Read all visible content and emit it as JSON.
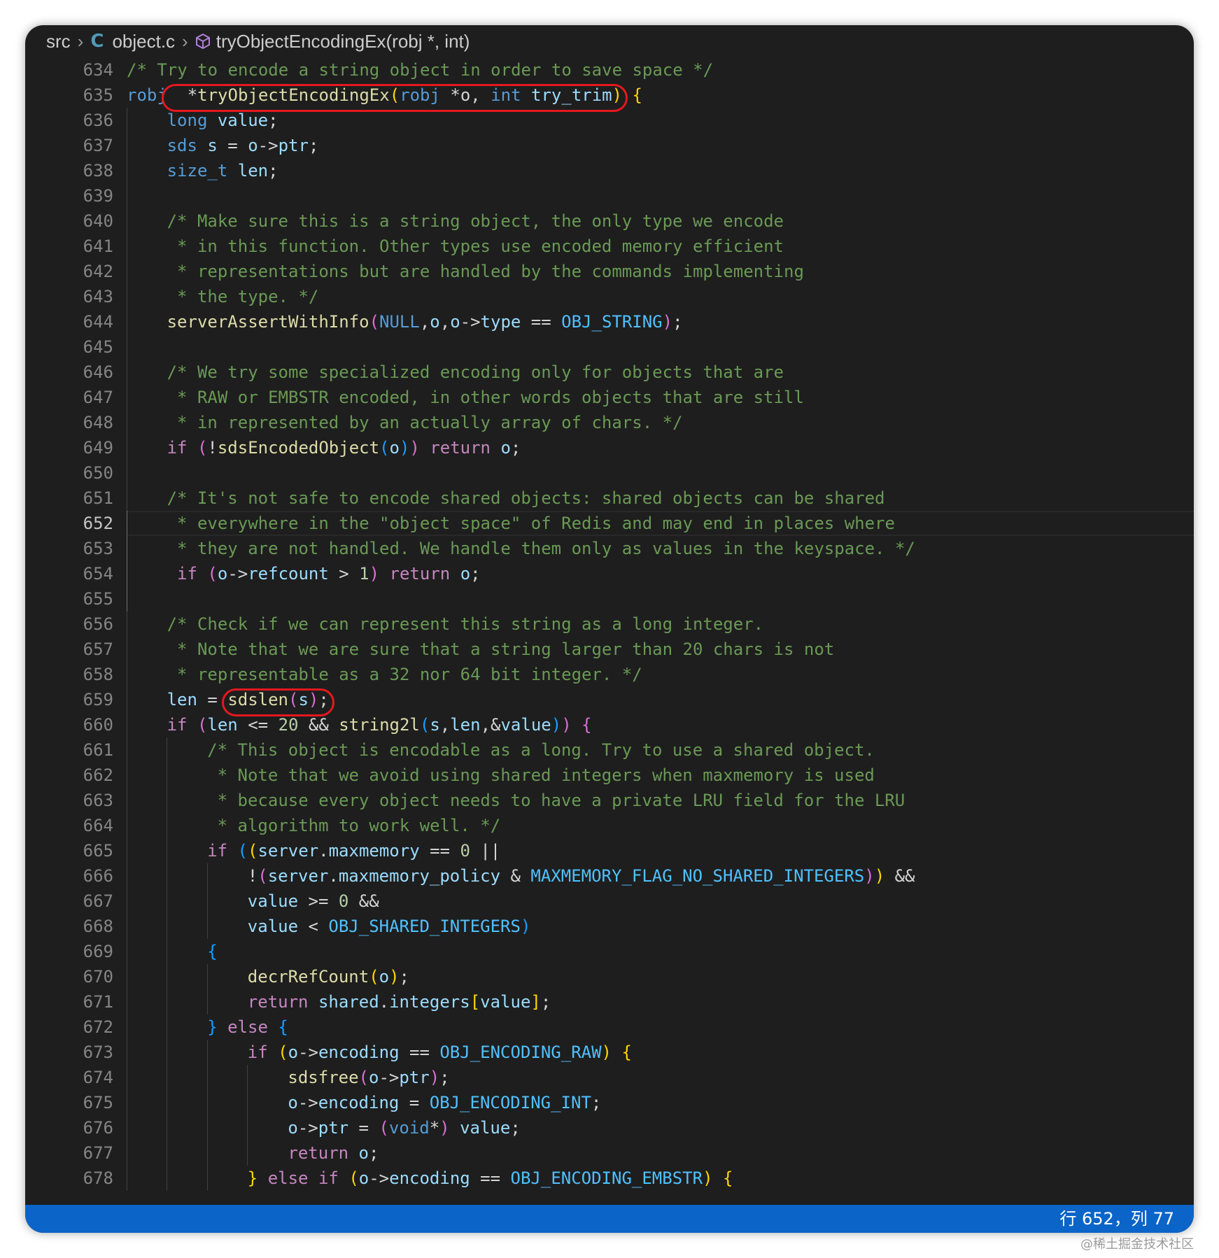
{
  "breadcrumb": {
    "folder": "src",
    "file_icon": "C",
    "file": "object.c",
    "symbol": "tryObjectEncodingEx(robj *, int)"
  },
  "editor": {
    "active_line": 652,
    "lines": [
      {
        "n": 634,
        "indent": 0,
        "tokens": [
          [
            "cmt",
            "/* Try to encode a string object in order to save space */"
          ]
        ]
      },
      {
        "n": 635,
        "indent": 0,
        "tokens": [
          [
            "kw",
            "robj"
          ],
          [
            "",
            "  *"
          ],
          [
            "fn",
            "tryObjectEncodingEx"
          ],
          [
            "b1",
            "("
          ],
          [
            "kw",
            "robj"
          ],
          [
            "",
            " *o, "
          ],
          [
            "kw",
            "int"
          ],
          [
            "",
            " "
          ],
          [
            "var",
            "try_trim"
          ],
          [
            "b1",
            ")"
          ],
          [
            "",
            " "
          ],
          [
            "b1",
            "{"
          ]
        ]
      },
      {
        "n": 636,
        "indent": 1,
        "tokens": [
          [
            "kw",
            "long"
          ],
          [
            "",
            " "
          ],
          [
            "var",
            "value"
          ],
          [
            "",
            ";"
          ]
        ]
      },
      {
        "n": 637,
        "indent": 1,
        "tokens": [
          [
            "kw",
            "sds"
          ],
          [
            "",
            " "
          ],
          [
            "var",
            "s"
          ],
          [
            "",
            " = "
          ],
          [
            "var",
            "o"
          ],
          [
            "",
            "->"
          ],
          [
            "var",
            "ptr"
          ],
          [
            "",
            ";"
          ]
        ]
      },
      {
        "n": 638,
        "indent": 1,
        "tokens": [
          [
            "kw",
            "size_t"
          ],
          [
            "",
            " "
          ],
          [
            "var",
            "len"
          ],
          [
            "",
            ";"
          ]
        ]
      },
      {
        "n": 639,
        "indent": 1,
        "tokens": []
      },
      {
        "n": 640,
        "indent": 1,
        "tokens": [
          [
            "cmt",
            "/* Make sure this is a string object, the only type we encode"
          ]
        ]
      },
      {
        "n": 641,
        "indent": 1,
        "tokens": [
          [
            "cmt",
            " * in this function. Other types use encoded memory efficient"
          ]
        ]
      },
      {
        "n": 642,
        "indent": 1,
        "tokens": [
          [
            "cmt",
            " * representations but are handled by the commands implementing"
          ]
        ]
      },
      {
        "n": 643,
        "indent": 1,
        "tokens": [
          [
            "cmt",
            " * the type. */"
          ]
        ]
      },
      {
        "n": 644,
        "indent": 1,
        "tokens": [
          [
            "fn",
            "serverAssertWithInfo"
          ],
          [
            "b2",
            "("
          ],
          [
            "kw",
            "NULL"
          ],
          [
            "",
            ","
          ],
          [
            "var",
            "o"
          ],
          [
            "",
            ","
          ],
          [
            "var",
            "o"
          ],
          [
            "",
            "->"
          ],
          [
            "var",
            "type"
          ],
          [
            "",
            " == "
          ],
          [
            "mac",
            "OBJ_STRING"
          ],
          [
            "b2",
            ")"
          ],
          [
            "",
            ";"
          ]
        ]
      },
      {
        "n": 645,
        "indent": 1,
        "tokens": []
      },
      {
        "n": 646,
        "indent": 1,
        "tokens": [
          [
            "cmt",
            "/* We try some specialized encoding only for objects that are"
          ]
        ]
      },
      {
        "n": 647,
        "indent": 1,
        "tokens": [
          [
            "cmt",
            " * RAW or EMBSTR encoded, in other words objects that are still"
          ]
        ]
      },
      {
        "n": 648,
        "indent": 1,
        "tokens": [
          [
            "cmt",
            " * in represented by an actually array of chars. */"
          ]
        ]
      },
      {
        "n": 649,
        "indent": 1,
        "tokens": [
          [
            "ctl",
            "if"
          ],
          [
            "",
            " "
          ],
          [
            "b2",
            "("
          ],
          [
            "",
            "!"
          ],
          [
            "fn",
            "sdsEncodedObject"
          ],
          [
            "b3",
            "("
          ],
          [
            "var",
            "o"
          ],
          [
            "b3",
            ")"
          ],
          [
            "b2",
            ")"
          ],
          [
            "",
            " "
          ],
          [
            "ctl",
            "return"
          ],
          [
            "",
            " "
          ],
          [
            "var",
            "o"
          ],
          [
            "",
            ";"
          ]
        ]
      },
      {
        "n": 650,
        "indent": 1,
        "tokens": []
      },
      {
        "n": 651,
        "indent": 1,
        "tokens": [
          [
            "cmt",
            "/* It's not safe to encode shared objects: shared objects can be shared"
          ]
        ]
      },
      {
        "n": 652,
        "indent": 1,
        "tokens": [
          [
            "cmt",
            " * everywhere in the \"object space\" of Redis and may end in places where"
          ]
        ]
      },
      {
        "n": 653,
        "indent": 1,
        "tokens": [
          [
            "cmt",
            " * they are not handled. We handle them only as values in the keyspace. */"
          ]
        ]
      },
      {
        "n": 654,
        "indent": 1,
        "tokens": [
          [
            "ctl",
            " if"
          ],
          [
            "",
            " "
          ],
          [
            "b2",
            "("
          ],
          [
            "var",
            "o"
          ],
          [
            "",
            "->"
          ],
          [
            "var",
            "refcount"
          ],
          [
            "",
            " > "
          ],
          [
            "num",
            "1"
          ],
          [
            "b2",
            ")"
          ],
          [
            "",
            " "
          ],
          [
            "ctl",
            "return"
          ],
          [
            "",
            " "
          ],
          [
            "var",
            "o"
          ],
          [
            "",
            ";"
          ]
        ]
      },
      {
        "n": 655,
        "indent": 1,
        "tokens": []
      },
      {
        "n": 656,
        "indent": 1,
        "tokens": [
          [
            "cmt",
            "/* Check if we can represent this string as a long integer."
          ]
        ]
      },
      {
        "n": 657,
        "indent": 1,
        "tokens": [
          [
            "cmt",
            " * Note that we are sure that a string larger than 20 chars is not"
          ]
        ]
      },
      {
        "n": 658,
        "indent": 1,
        "tokens": [
          [
            "cmt",
            " * representable as a 32 nor 64 bit integer. */"
          ]
        ]
      },
      {
        "n": 659,
        "indent": 1,
        "tokens": [
          [
            "var",
            "len"
          ],
          [
            "",
            " = "
          ],
          [
            "fn",
            "sdslen"
          ],
          [
            "b2",
            "("
          ],
          [
            "var",
            "s"
          ],
          [
            "b2",
            ")"
          ],
          [
            "",
            ";"
          ]
        ]
      },
      {
        "n": 660,
        "indent": 1,
        "tokens": [
          [
            "ctl",
            "if"
          ],
          [
            "",
            " "
          ],
          [
            "b2",
            "("
          ],
          [
            "var",
            "len"
          ],
          [
            "",
            " <= "
          ],
          [
            "num",
            "20"
          ],
          [
            "",
            " && "
          ],
          [
            "fn",
            "string2l"
          ],
          [
            "b3",
            "("
          ],
          [
            "var",
            "s"
          ],
          [
            "",
            ","
          ],
          [
            "var",
            "len"
          ],
          [
            "",
            ",&"
          ],
          [
            "var",
            "value"
          ],
          [
            "b3",
            ")"
          ],
          [
            "b2",
            ")"
          ],
          [
            "",
            " "
          ],
          [
            "b2",
            "{"
          ]
        ]
      },
      {
        "n": 661,
        "indent": 2,
        "tokens": [
          [
            "cmt",
            "/* This object is encodable as a long. Try to use a shared object."
          ]
        ]
      },
      {
        "n": 662,
        "indent": 2,
        "tokens": [
          [
            "cmt",
            " * Note that we avoid using shared integers when maxmemory is used"
          ]
        ]
      },
      {
        "n": 663,
        "indent": 2,
        "tokens": [
          [
            "cmt",
            " * because every object needs to have a private LRU field for the LRU"
          ]
        ]
      },
      {
        "n": 664,
        "indent": 2,
        "tokens": [
          [
            "cmt",
            " * algorithm to work well. */"
          ]
        ]
      },
      {
        "n": 665,
        "indent": 2,
        "tokens": [
          [
            "ctl",
            "if"
          ],
          [
            "",
            " "
          ],
          [
            "b3",
            "("
          ],
          [
            "b1",
            "("
          ],
          [
            "var",
            "server"
          ],
          [
            "",
            "."
          ],
          [
            "var",
            "maxmemory"
          ],
          [
            "",
            " == "
          ],
          [
            "num",
            "0"
          ],
          [
            "",
            " ||"
          ]
        ]
      },
      {
        "n": 666,
        "indent": 3,
        "tokens": [
          [
            "",
            "!"
          ],
          [
            "b2",
            "("
          ],
          [
            "var",
            "server"
          ],
          [
            "",
            "."
          ],
          [
            "var",
            "maxmemory_policy"
          ],
          [
            "",
            " & "
          ],
          [
            "mac",
            "MAXMEMORY_FLAG_NO_SHARED_INTEGERS"
          ],
          [
            "b2",
            ")"
          ],
          [
            "b1",
            ")"
          ],
          [
            "",
            " &&"
          ]
        ]
      },
      {
        "n": 667,
        "indent": 3,
        "tokens": [
          [
            "var",
            "value"
          ],
          [
            "",
            " >= "
          ],
          [
            "num",
            "0"
          ],
          [
            "",
            " &&"
          ]
        ]
      },
      {
        "n": 668,
        "indent": 3,
        "tokens": [
          [
            "var",
            "value"
          ],
          [
            "",
            " < "
          ],
          [
            "mac",
            "OBJ_SHARED_INTEGERS"
          ],
          [
            "b3",
            ")"
          ]
        ]
      },
      {
        "n": 669,
        "indent": 2,
        "tokens": [
          [
            "b3",
            "{"
          ]
        ]
      },
      {
        "n": 670,
        "indent": 3,
        "tokens": [
          [
            "fn",
            "decrRefCount"
          ],
          [
            "b1",
            "("
          ],
          [
            "var",
            "o"
          ],
          [
            "b1",
            ")"
          ],
          [
            "",
            ";"
          ]
        ]
      },
      {
        "n": 671,
        "indent": 3,
        "tokens": [
          [
            "ctl",
            "return"
          ],
          [
            "",
            " "
          ],
          [
            "var",
            "shared"
          ],
          [
            "",
            "."
          ],
          [
            "var",
            "integers"
          ],
          [
            "b1",
            "["
          ],
          [
            "var",
            "value"
          ],
          [
            "b1",
            "]"
          ],
          [
            "",
            ";"
          ]
        ]
      },
      {
        "n": 672,
        "indent": 2,
        "tokens": [
          [
            "b3",
            "}"
          ],
          [
            "",
            " "
          ],
          [
            "ctl",
            "else"
          ],
          [
            "",
            " "
          ],
          [
            "b3",
            "{"
          ]
        ]
      },
      {
        "n": 673,
        "indent": 3,
        "tokens": [
          [
            "ctl",
            "if"
          ],
          [
            "",
            " "
          ],
          [
            "b1",
            "("
          ],
          [
            "var",
            "o"
          ],
          [
            "",
            "->"
          ],
          [
            "var",
            "encoding"
          ],
          [
            "",
            " == "
          ],
          [
            "mac",
            "OBJ_ENCODING_RAW"
          ],
          [
            "b1",
            ")"
          ],
          [
            "",
            " "
          ],
          [
            "b1",
            "{"
          ]
        ]
      },
      {
        "n": 674,
        "indent": 4,
        "tokens": [
          [
            "fn",
            "sdsfree"
          ],
          [
            "b2",
            "("
          ],
          [
            "var",
            "o"
          ],
          [
            "",
            "->"
          ],
          [
            "var",
            "ptr"
          ],
          [
            "b2",
            ")"
          ],
          [
            "",
            ";"
          ]
        ]
      },
      {
        "n": 675,
        "indent": 4,
        "tokens": [
          [
            "var",
            "o"
          ],
          [
            "",
            "->"
          ],
          [
            "var",
            "encoding"
          ],
          [
            "",
            " = "
          ],
          [
            "mac",
            "OBJ_ENCODING_INT"
          ],
          [
            "",
            ";"
          ]
        ]
      },
      {
        "n": 676,
        "indent": 4,
        "tokens": [
          [
            "var",
            "o"
          ],
          [
            "",
            "->"
          ],
          [
            "var",
            "ptr"
          ],
          [
            "",
            " = "
          ],
          [
            "b2",
            "("
          ],
          [
            "kw",
            "void"
          ],
          [
            "",
            "*"
          ],
          [
            "b2",
            ")"
          ],
          [
            "",
            " "
          ],
          [
            "var",
            "value"
          ],
          [
            "",
            ";"
          ]
        ]
      },
      {
        "n": 677,
        "indent": 4,
        "tokens": [
          [
            "ctl",
            "return"
          ],
          [
            "",
            " "
          ],
          [
            "var",
            "o"
          ],
          [
            "",
            ";"
          ]
        ]
      },
      {
        "n": 678,
        "indent": 3,
        "tokens": [
          [
            "b1",
            "}"
          ],
          [
            "",
            " "
          ],
          [
            "ctl",
            "else"
          ],
          [
            "",
            " "
          ],
          [
            "ctl",
            "if"
          ],
          [
            "",
            " "
          ],
          [
            "b1",
            "("
          ],
          [
            "var",
            "o"
          ],
          [
            "",
            "->"
          ],
          [
            "var",
            "encoding"
          ],
          [
            "",
            " == "
          ],
          [
            "mac",
            "OBJ_ENCODING_EMBSTR"
          ],
          [
            "b1",
            ")"
          ],
          [
            "",
            " "
          ],
          [
            "b1",
            "{"
          ]
        ]
      }
    ]
  },
  "status": {
    "cursor": "行 652，列 77"
  },
  "watermark": "@稀土掘金技术社区",
  "colors": {
    "statusbar": "#0b64c8",
    "highlight_ring": "#e5181f",
    "editor_bg": "#1e1e1e"
  }
}
